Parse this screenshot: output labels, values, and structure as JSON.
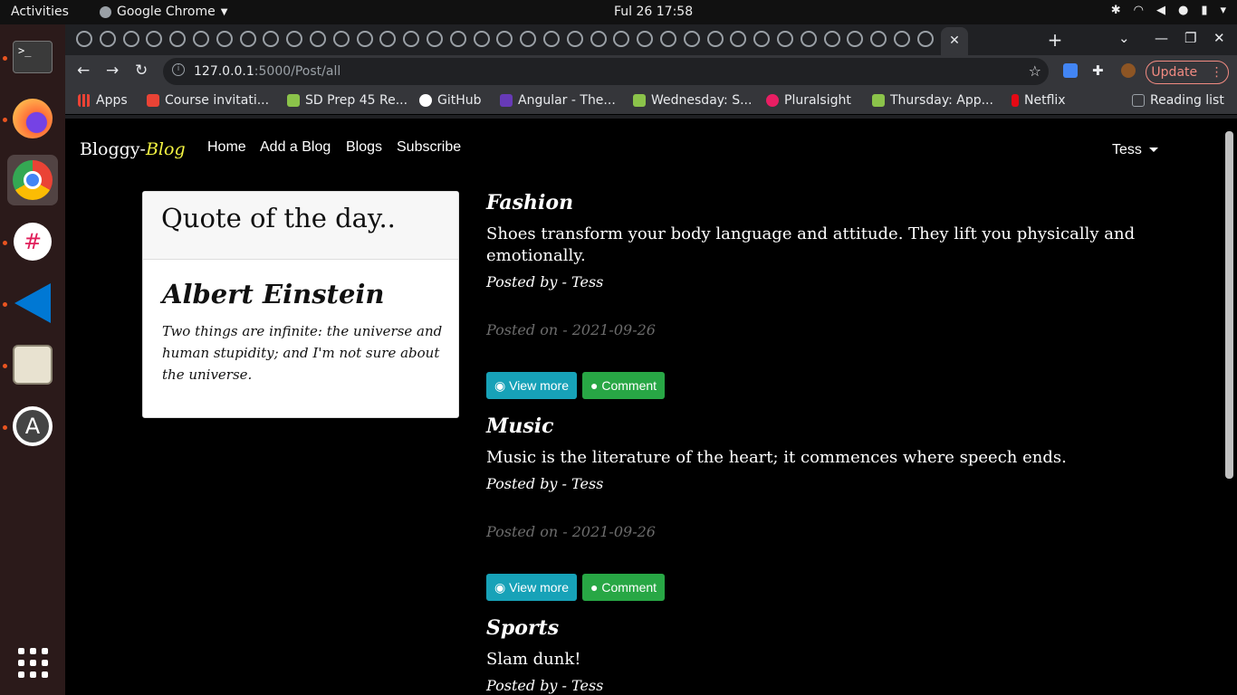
{
  "system": {
    "activities": "Activities",
    "app_name": "Google Chrome",
    "clock": "Ful 26  17:58"
  },
  "browser": {
    "url_host": "127.0.0.1",
    "url_path": ":5000/Post/all",
    "update_label": "Update",
    "bookmarks": [
      {
        "label": "Apps",
        "color": "#ea4335"
      },
      {
        "label": "Course invitati...",
        "color": "#ea4335"
      },
      {
        "label": "SD Prep 45 Re...",
        "color": "#8bc34a"
      },
      {
        "label": "GitHub",
        "color": "#ffffff"
      },
      {
        "label": "Angular - The...",
        "color": "#673ab7"
      },
      {
        "label": "Wednesday: S...",
        "color": "#8bc34a"
      },
      {
        "label": "Pluralsight",
        "color": "#e91e63"
      },
      {
        "label": "Thursday: App...",
        "color": "#8bc34a"
      },
      {
        "label": "Netflix",
        "color": "#e50914"
      },
      {
        "label": "Reading list",
        "color": "#9aa0a6"
      }
    ]
  },
  "site": {
    "brand_main": "Bloggy-",
    "brand_accent": "Blog",
    "nav": [
      "Home",
      "Add a Blog",
      "Blogs",
      "Subscribe"
    ],
    "user": "Tess"
  },
  "quote": {
    "heading": "Quote of the day..",
    "author": "Albert Einstein",
    "text": "Two things are infinite: the universe and human stupidity; and I'm not sure about the universe."
  },
  "posts": [
    {
      "title": "Fashion",
      "body": "Shoes transform your body language and attitude. They lift you physically and emotionally.",
      "by": "Posted by - Tess",
      "on": "Posted on - 2021-09-26",
      "view_label": "View more",
      "comment_label": "Comment"
    },
    {
      "title": "Music",
      "body": "Music is the literature of the heart; it commences where speech ends.",
      "by": "Posted by - Tess",
      "on": "Posted on - 2021-09-26",
      "view_label": "View more",
      "comment_label": "Comment"
    },
    {
      "title": "Sports",
      "body": "Slam dunk!",
      "by": "Posted by - Tess"
    }
  ]
}
